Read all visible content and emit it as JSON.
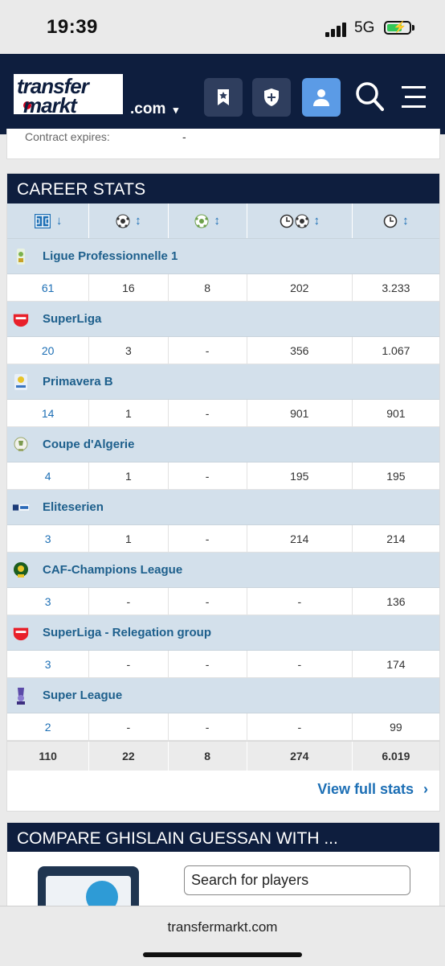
{
  "status_bar": {
    "time": "19:39",
    "network": "5G"
  },
  "header": {
    "logo_line1": "transfer",
    "logo_line2": "markt",
    "domain_select": ".com",
    "domain_caret": "▾",
    "icons": [
      "bookmark-star-icon",
      "shield-plus-icon",
      "user-icon",
      "search-icon",
      "menu-icon"
    ]
  },
  "contract": {
    "label": "Contract expires:",
    "value": "-"
  },
  "career_stats": {
    "title": "CAREER STATS",
    "columns": [
      {
        "icon": "matches-pitch-icon",
        "sort": "↓"
      },
      {
        "icon": "goals-ball-icon",
        "sort": "↕"
      },
      {
        "icon": "assists-ball-icon",
        "sort": "↕"
      },
      {
        "icon": "minutes-per-goal-icon",
        "sort": "↕"
      },
      {
        "icon": "minutes-played-icon",
        "sort": "↕"
      }
    ],
    "competitions": [
      {
        "name": "Ligue Professionnelle 1",
        "logo": "ligue-professionnelle-1-logo",
        "stats": [
          "61",
          "16",
          "8",
          "202",
          "3.233"
        ]
      },
      {
        "name": "SuperLiga",
        "logo": "superliga-logo",
        "stats": [
          "20",
          "3",
          "-",
          "356",
          "1.067"
        ]
      },
      {
        "name": "Primavera B",
        "logo": "primavera-b-logo",
        "stats": [
          "14",
          "1",
          "-",
          "901",
          "901"
        ]
      },
      {
        "name": "Coupe d'Algerie",
        "logo": "coupe-dalgerie-logo",
        "stats": [
          "4",
          "1",
          "-",
          "195",
          "195"
        ]
      },
      {
        "name": "Eliteserien",
        "logo": "eliteserien-logo",
        "stats": [
          "3",
          "1",
          "-",
          "214",
          "214"
        ]
      },
      {
        "name": "CAF-Champions League",
        "logo": "caf-champions-league-logo",
        "stats": [
          "3",
          "-",
          "-",
          "-",
          "136"
        ]
      },
      {
        "name": "SuperLiga - Relegation group",
        "logo": "superliga-relegation-logo",
        "stats": [
          "3",
          "-",
          "-",
          "-",
          "174"
        ]
      },
      {
        "name": "Super League",
        "logo": "super-league-logo",
        "stats": [
          "2",
          "-",
          "-",
          "-",
          "99"
        ]
      }
    ],
    "totals": [
      "110",
      "22",
      "8",
      "274",
      "6.019"
    ],
    "view_full": "View full stats",
    "view_full_chevron": "›"
  },
  "compare": {
    "title": "COMPARE GHISLAIN GUESSAN WITH ...",
    "search_value": "Search for players"
  },
  "browser": {
    "url": "transfermarkt.com"
  },
  "colors": {
    "navy": "#0e1e3e",
    "row_blue": "#d3e0eb",
    "link_blue": "#1d6fb5",
    "active_button": "#5b9be6"
  }
}
